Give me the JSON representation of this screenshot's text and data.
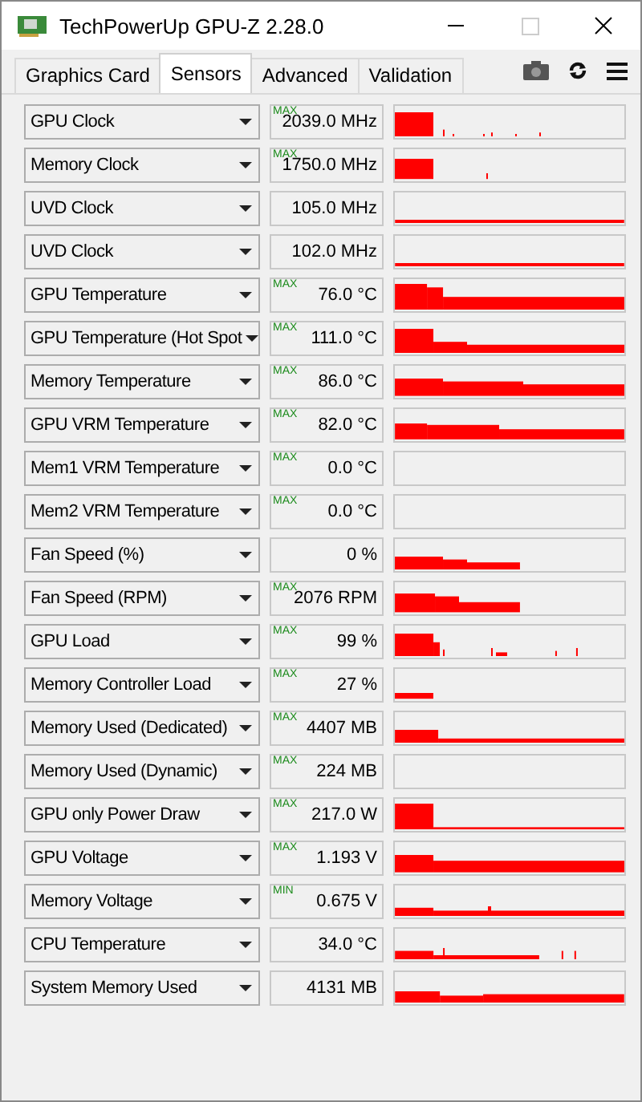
{
  "window": {
    "title": "TechPowerUp GPU-Z 2.28.0"
  },
  "tabs": [
    {
      "label": "Graphics Card",
      "selected": false
    },
    {
      "label": "Sensors",
      "selected": true
    },
    {
      "label": "Advanced",
      "selected": false
    },
    {
      "label": "Validation",
      "selected": false
    }
  ],
  "sensors": [
    {
      "name": "GPU Clock",
      "badge": "MAX",
      "value": "2039.0 MHz"
    },
    {
      "name": "Memory Clock",
      "badge": "MAX",
      "value": "1750.0 MHz"
    },
    {
      "name": "UVD Clock",
      "value": "105.0 MHz"
    },
    {
      "name": "UVD Clock",
      "value": "102.0 MHz"
    },
    {
      "name": "GPU Temperature",
      "badge": "MAX",
      "value": "76.0 °C"
    },
    {
      "name": "GPU Temperature (Hot Spot",
      "badge": "MAX",
      "value": "111.0 °C"
    },
    {
      "name": "Memory Temperature",
      "badge": "MAX",
      "value": "86.0 °C"
    },
    {
      "name": "GPU VRM Temperature",
      "badge": "MAX",
      "value": "82.0 °C"
    },
    {
      "name": "Mem1 VRM Temperature",
      "badge": "MAX",
      "value": "0.0 °C"
    },
    {
      "name": "Mem2 VRM Temperature",
      "badge": "MAX",
      "value": "0.0 °C"
    },
    {
      "name": "Fan Speed (%)",
      "value": "0 %"
    },
    {
      "name": "Fan Speed (RPM)",
      "badge": "MAX",
      "value": "2076 RPM"
    },
    {
      "name": "GPU Load",
      "badge": "MAX",
      "value": "99 %"
    },
    {
      "name": "Memory Controller Load",
      "badge": "MAX",
      "value": "27 %"
    },
    {
      "name": "Memory Used (Dedicated)",
      "badge": "MAX",
      "value": "4407 MB"
    },
    {
      "name": "Memory Used (Dynamic)",
      "badge": "MAX",
      "value": "224 MB"
    },
    {
      "name": "GPU only Power Draw",
      "badge": "MAX",
      "value": "217.0 W"
    },
    {
      "name": "GPU Voltage",
      "badge": "MAX",
      "value": "1.193 V"
    },
    {
      "name": "Memory Voltage",
      "badge": "MIN",
      "value": "0.675 V"
    },
    {
      "name": "CPU Temperature",
      "value": "34.0 °C"
    },
    {
      "name": "System Memory Used",
      "value": "4131 MB"
    }
  ]
}
